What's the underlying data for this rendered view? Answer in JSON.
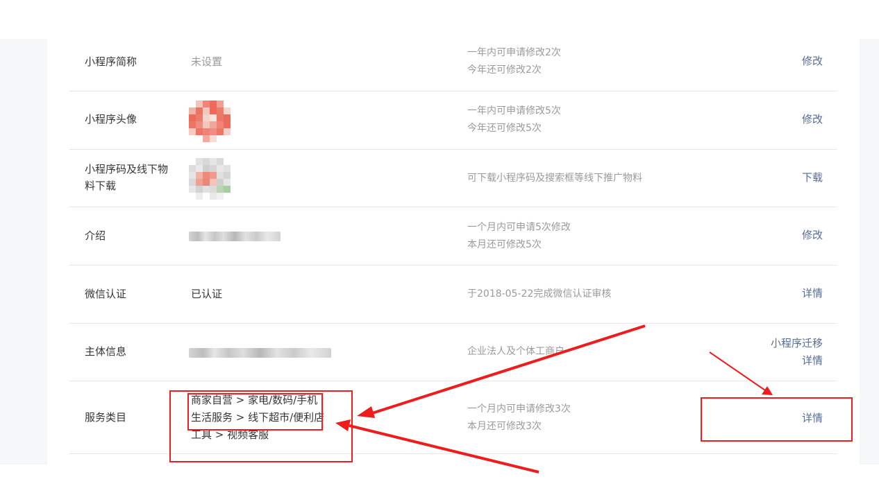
{
  "rows": [
    {
      "label": "小程序简称",
      "value": "未设置",
      "desc": [
        "一年内可申请修改2次",
        "今年还可修改2次"
      ],
      "actions": [
        "修改"
      ]
    },
    {
      "label": "小程序头像",
      "desc": [
        "一年内可申请修改5次",
        "今年还可修改5次"
      ],
      "actions": [
        "修改"
      ]
    },
    {
      "label": "小程序码及线下物料下载",
      "desc": [
        "可下载小程序码及搜索框等线下推广物料"
      ],
      "actions": [
        "下载"
      ]
    },
    {
      "label": "介绍",
      "desc": [
        "一个月内可申请5次修改",
        "本月还可修改5次"
      ],
      "actions": [
        "修改"
      ]
    },
    {
      "label": "微信认证",
      "value": "已认证",
      "desc": [
        "于2018-05-22完成微信认证审核"
      ],
      "actions": [
        "详情"
      ]
    },
    {
      "label": "主体信息",
      "desc": [
        "企业法人及个体工商户"
      ],
      "actions": [
        "小程序迁移",
        "详情"
      ]
    },
    {
      "label": "服务类目",
      "categories": [
        "商家自营 > 家电/数码/手机",
        "生活服务 > 线下超市/便利店",
        "工具 > 视频客服"
      ],
      "desc": [
        "一个月内可申请修改3次",
        "本月还可修改3次"
      ],
      "actions": [
        "详情"
      ]
    }
  ],
  "colors": {
    "link": "#576b95",
    "muted_text": "#9a9a9a",
    "annotation": "#ee1c1c"
  }
}
